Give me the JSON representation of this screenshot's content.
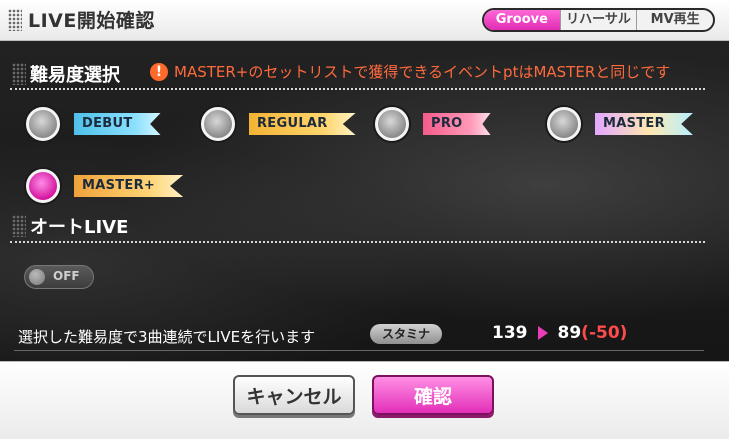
{
  "header": {
    "title": "LIVE開始確認",
    "tabs": [
      {
        "label": "Groove",
        "active": true
      },
      {
        "label": "リハーサル",
        "active": false
      },
      {
        "label": "MV再生",
        "active": false
      }
    ]
  },
  "difficulty": {
    "title": "難易度選択",
    "warning": "MASTER+のセットリストで獲得できるイベントptはMASTERと同じです",
    "warning_icon": "exclamation-icon",
    "options": [
      {
        "label": "DEBUT",
        "selected": false
      },
      {
        "label": "REGULAR",
        "selected": false
      },
      {
        "label": "PRO",
        "selected": false
      },
      {
        "label": "MASTER",
        "selected": false
      },
      {
        "label": "MASTER+",
        "selected": true
      }
    ]
  },
  "auto_live": {
    "title": "オートLIVE",
    "toggle_label": "OFF",
    "enabled": false
  },
  "info": {
    "message": "選択した難易度で3曲連続でLIVEを行います",
    "stamina_label": "スタミナ",
    "stamina_current": "139",
    "stamina_after": "89",
    "stamina_delta": "(-50)"
  },
  "footer": {
    "cancel_label": "キャンセル",
    "confirm_label": "確認"
  },
  "colors": {
    "accent_pink": "#e22fb8",
    "warning_orange": "#ff6a3d",
    "delta_red": "#ff4b4b"
  }
}
